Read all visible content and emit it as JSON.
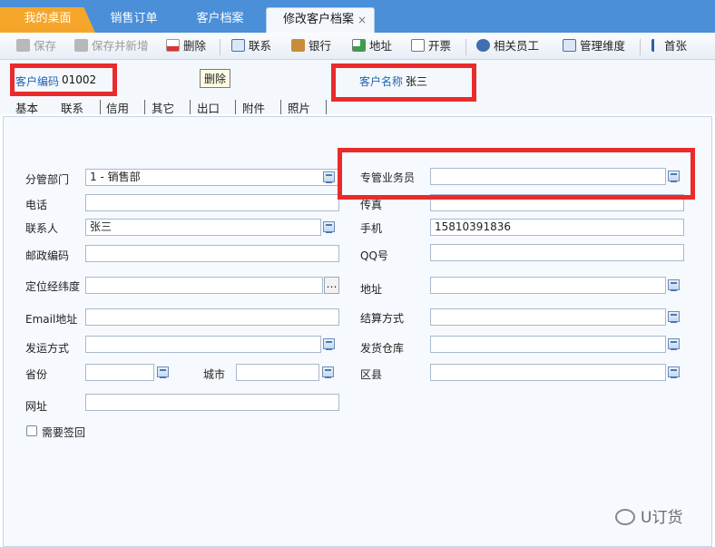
{
  "tabs": {
    "home": "我的桌面",
    "sales_order": "销售订单",
    "customer_archive": "客户档案",
    "edit_customer": "修改客户档案",
    "close": "×"
  },
  "toolbar": {
    "save": "保存",
    "save_new": "保存并新增",
    "delete": "删除",
    "contact": "联系",
    "bank": "银行",
    "address": "地址",
    "invoice": "开票",
    "staff": "相关员工",
    "dimension": "管理维度",
    "first": "首张"
  },
  "header": {
    "code_label": "客户编码",
    "code_value": "01002",
    "name_label": "客户名称",
    "name_value": "张三",
    "tooltip": "删除"
  },
  "subtabs": [
    "基本",
    "联系",
    "信用",
    "其它",
    "出口",
    "附件",
    "照片"
  ],
  "form": {
    "dept_label": "分管部门",
    "dept_value": "1 - 销售部",
    "phone_label": "电话",
    "contact_label": "联系人",
    "contact_value": "张三",
    "zip_label": "邮政编码",
    "geo_label": "定位经纬度",
    "email_label": "Email地址",
    "ship_label": "发运方式",
    "province_label": "省份",
    "city_label": "城市",
    "website_label": "网址",
    "sign_label": "需要签回",
    "salesman_label": "专管业务员",
    "fax_label": "传真",
    "mobile_label": "手机",
    "mobile_value": "15810391836",
    "qq_label": "QQ号",
    "addr_label": "地址",
    "settle_label": "结算方式",
    "warehouse_label": "发货仓库",
    "district_label": "区县"
  },
  "watermark": "U订货"
}
